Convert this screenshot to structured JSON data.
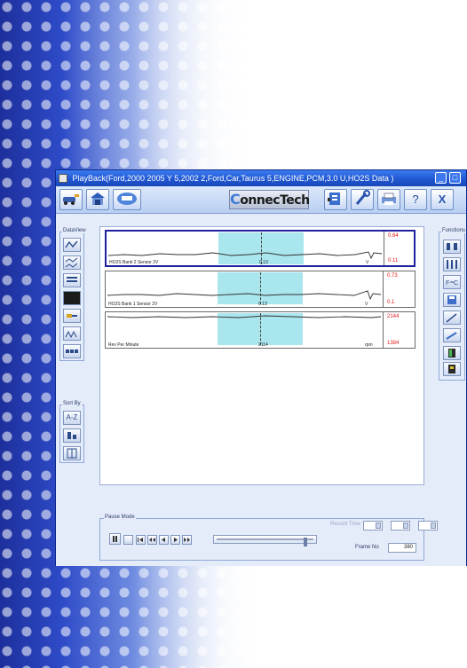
{
  "window": {
    "title": "PlayBack(Ford,2000 2005 Y 5,2002 2,Ford,Car,Taurus 5,ENGINE,PCM,3.0 U,HO2S Data )"
  },
  "toolbar": {
    "logo_c": "C",
    "logo_rest": "onnecTech",
    "help_icon_glyph": "?",
    "exit_icon_glyph": "X"
  },
  "dataview": {
    "label": "DataView"
  },
  "sortby": {
    "label": "Sort By",
    "buttons": [
      "A-Z",
      "",
      ""
    ]
  },
  "functions": {
    "label": "Functions"
  },
  "graphs": [
    {
      "name": "HO2S Bank 2 Sensor 2V",
      "current": "0.13",
      "unit": "V",
      "max": "0.64",
      "min": "0.11"
    },
    {
      "name": "HO2S Bank 1 Sensor 2V",
      "current": "0.13",
      "unit": "V",
      "max": "0.73",
      "min": "0.1"
    },
    {
      "name": "Rev Per Minute",
      "current": "2114",
      "unit": "rpm",
      "max": "2144",
      "min": "1384"
    }
  ],
  "pause": {
    "label": "Pause Mode"
  },
  "record_time": {
    "label": "Record Time"
  },
  "frame": {
    "label": "Frame No",
    "value": "380"
  },
  "slider": {
    "position": 0.93
  },
  "colors": {
    "accent": "#2a5ed6",
    "highlight": "#a9e6ee",
    "minmax": "#e01818",
    "selected_border": "#1c22a0"
  }
}
